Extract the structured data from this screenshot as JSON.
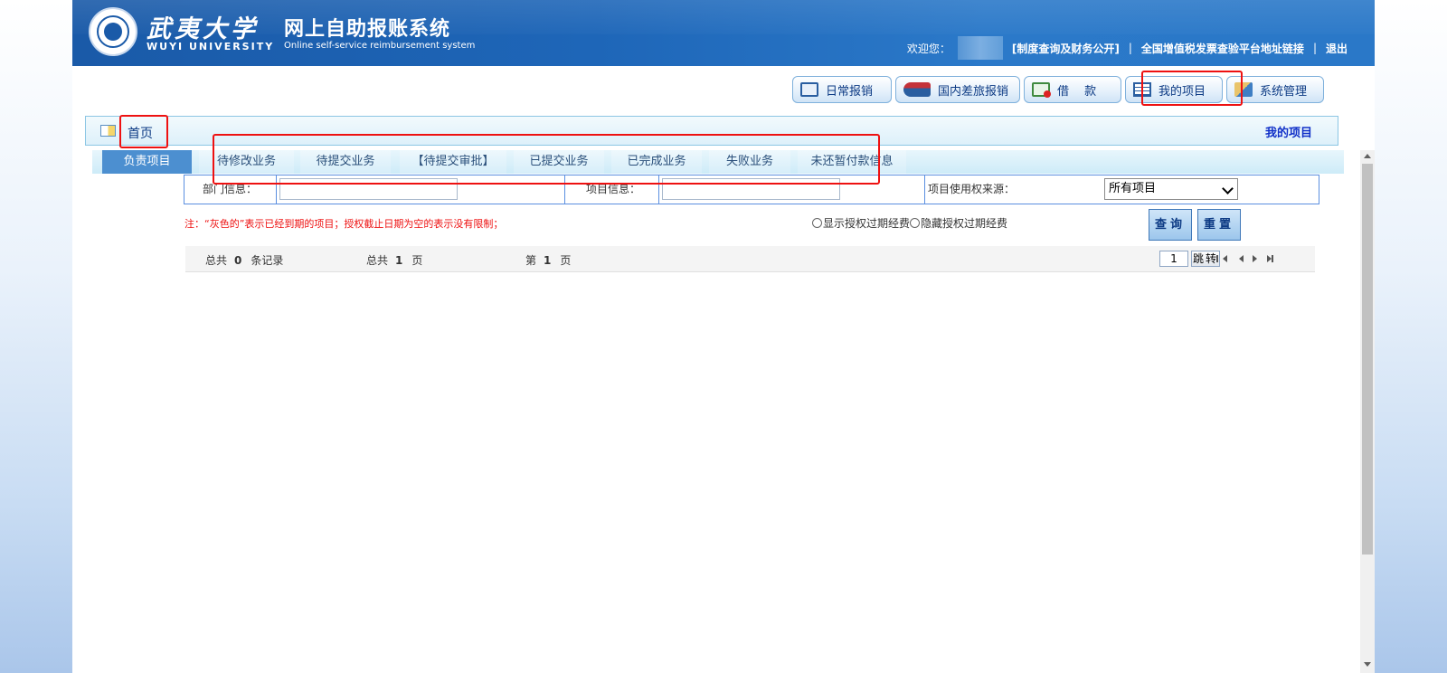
{
  "header": {
    "logo_cn": "武夷大学",
    "logo_en": "WUYI UNIVERSITY",
    "system_title": "网上自助报账系统",
    "system_subtitle": "Online self-service reimbursement system",
    "welcome": "欢迎您：",
    "links": {
      "policy": "[制度查询及财务公开]",
      "vat": "全国增值税发票查验平台地址链接",
      "logout": "退出"
    },
    "separator": "|"
  },
  "modules": [
    {
      "label": "日常报销",
      "icon": "notebook-icon"
    },
    {
      "label": "国内差旅报销",
      "icon": "train-icon"
    },
    {
      "label": "借　 款",
      "icon": "loan-icon"
    },
    {
      "label": "我的项目",
      "icon": "list-icon"
    },
    {
      "label": "系统管理",
      "icon": "system-icon"
    }
  ],
  "breadcrumb": {
    "home": "首页",
    "current": "我的项目"
  },
  "tabs": [
    "负责项目",
    "待修改业务",
    "待提交业务",
    "【待提交审批】",
    "已提交业务",
    "已完成业务",
    "失败业务",
    "未还暂付款信息"
  ],
  "active_tab": "负责项目",
  "filters": {
    "dept_label": "部门信息：",
    "dept_value": "",
    "project_label": "项目信息：",
    "project_value": "",
    "source_label": "项目使用权来源：",
    "source_selected": "所有项目"
  },
  "note": "注：“灰色的”表示已经到期的项目；授权截止日期为空的表示没有限制；",
  "radios": {
    "show": "显示授权过期经费",
    "hide": "隐藏授权过期经费"
  },
  "buttons": {
    "query": "查询",
    "reset": "重置",
    "jump": "跳转"
  },
  "pager": {
    "total_prefix": "总共",
    "total_records": "0",
    "records_suffix": "条记录",
    "pages_prefix": "总共",
    "total_pages": "1",
    "pages_suffix": "页",
    "current_prefix": "第",
    "current_page": "1",
    "current_suffix": "页",
    "page_input": "1"
  },
  "colors": {
    "header_blue": "#1e66b8",
    "highlight_red": "#ee1111",
    "tab_active": "#4c8fd0"
  }
}
